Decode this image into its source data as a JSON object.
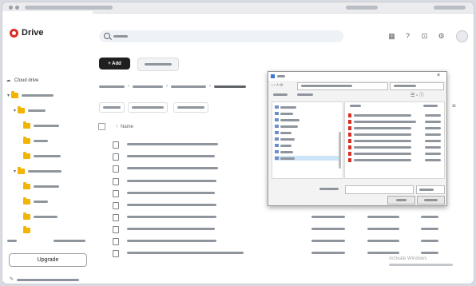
{
  "app": {
    "brand": "Drive",
    "brand_color": "#d93025"
  },
  "sidebar": {
    "items": [
      {
        "label": "Cloud drive",
        "icon": "cloud-icon"
      },
      {
        "label": "",
        "icon": "folder-icon"
      },
      {
        "label": "",
        "icon": "folder-icon"
      },
      {
        "label": "",
        "icon": "folder-icon"
      },
      {
        "label": "",
        "icon": "folder-icon"
      },
      {
        "label": "",
        "icon": "folder-icon"
      },
      {
        "label": "",
        "icon": "folder-icon"
      },
      {
        "label": "",
        "icon": "folder-icon"
      },
      {
        "label": "",
        "icon": "folder-icon"
      },
      {
        "label": "",
        "icon": "folder-icon"
      }
    ],
    "upgrade_label": "Upgrade"
  },
  "toolbar": {
    "add_label": "+ Add"
  },
  "list": {
    "name_header": "Name",
    "sort_arrow": "↑"
  },
  "dialog": {
    "close_glyph": "×"
  },
  "watermark": {
    "line1": "Activate Windows"
  }
}
